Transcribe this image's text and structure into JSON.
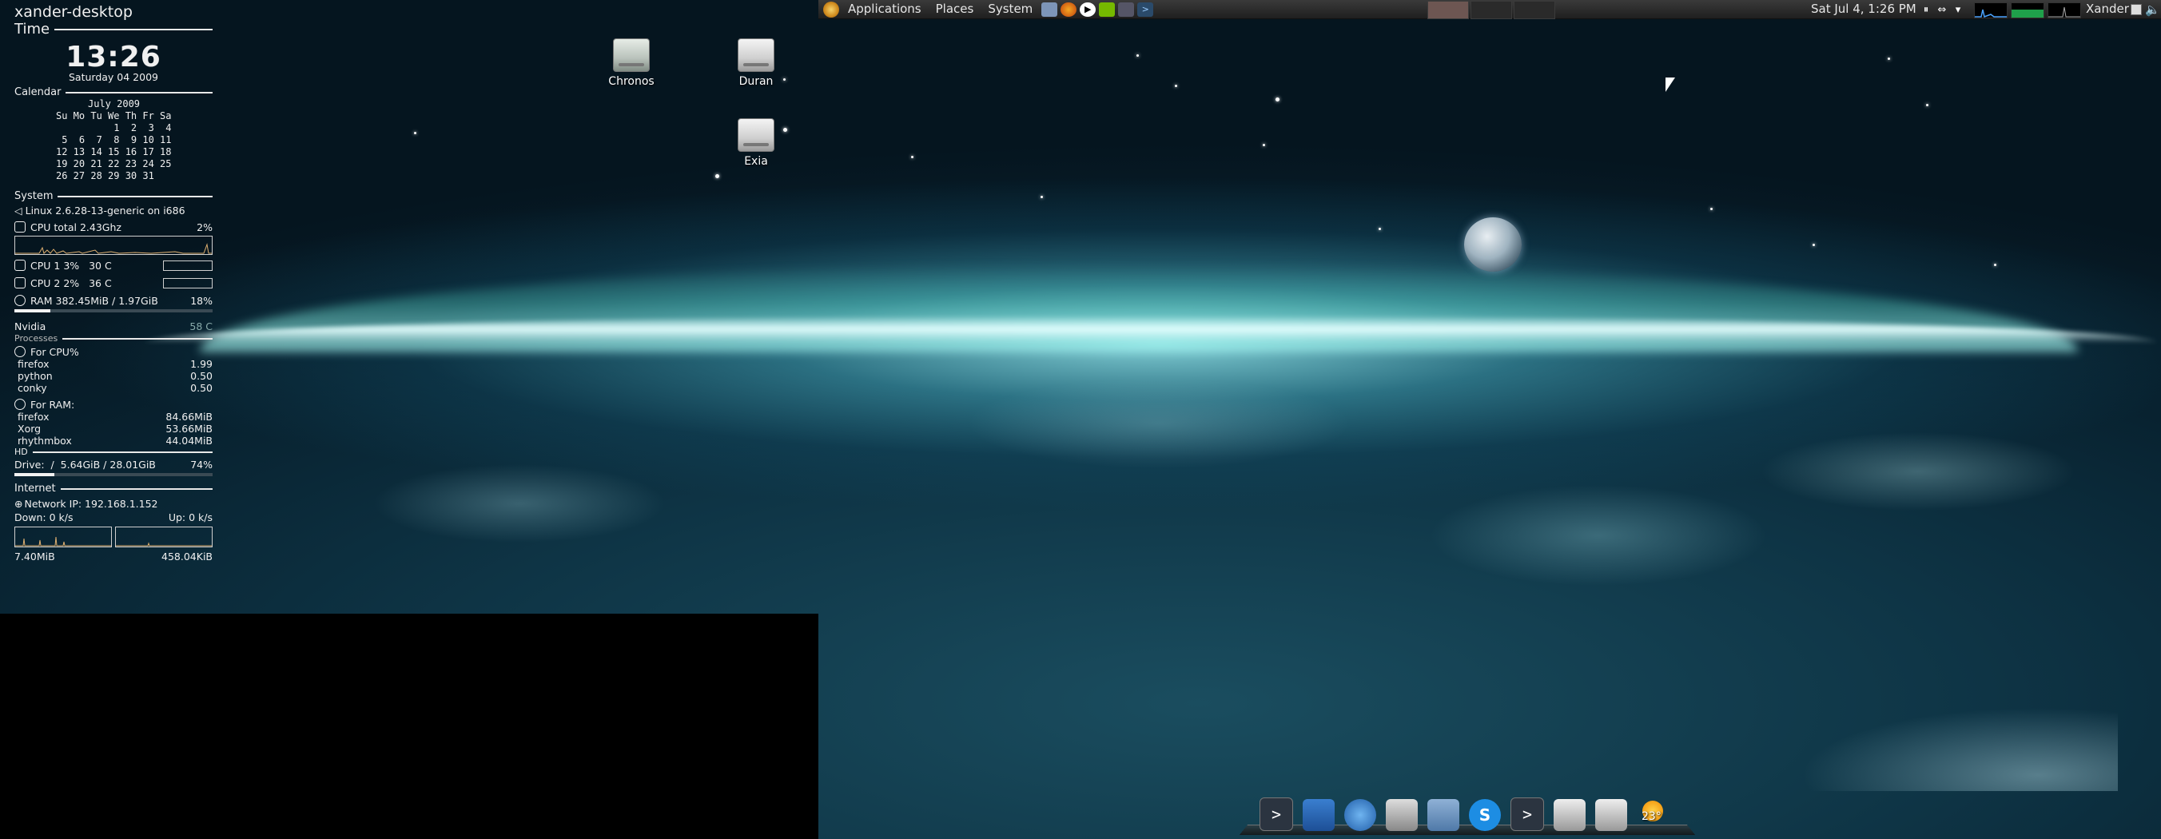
{
  "top_panel": {
    "menus": [
      "Applications",
      "Places",
      "System"
    ],
    "clock": "Sat Jul  4,  1:26 PM",
    "user": "Xander"
  },
  "desktop_icons": [
    {
      "label": "Chronos",
      "icon": "usb-drive-icon"
    },
    {
      "label": "Duran",
      "icon": "hard-drive-icon"
    },
    {
      "label": "Exia",
      "icon": "hard-drive-icon"
    }
  ],
  "conky": {
    "hostname": "xander-desktop",
    "time_section": "Time",
    "time": "13:26",
    "date": "Saturday 04 2009",
    "calendar_section": "Calendar",
    "calendar_month": "July 2009",
    "calendar_header": "Su Mo Tu We Th Fr Sa",
    "calendar_weeks": [
      "          1  2  3  4",
      " 5  6  7  8  9 10 11",
      "12 13 14 15 16 17 18",
      "19 20 21 22 23 24 25",
      "26 27 28 29 30 31"
    ],
    "system_section": "System",
    "kernel": "Linux 2.6.28-13-generic on i686",
    "cpu_total_label": "CPU total 2.43Ghz",
    "cpu_total_pct": "2%",
    "cpu1": "CPU 1 3%   30 C",
    "cpu2": "CPU 2 2%   36 C",
    "ram_label": "RAM  382.45MiB / 1.97GiB",
    "ram_pct": "18%",
    "ram_fraction": 0.18,
    "nvidia_label": "Nvidia",
    "nvidia_value": "58 C",
    "processes_section": "Processes",
    "cpu_procs_label": "For CPU%",
    "cpu_procs": [
      {
        "name": "firefox",
        "value": "1.99"
      },
      {
        "name": "python",
        "value": "0.50"
      },
      {
        "name": "conky",
        "value": "0.50"
      }
    ],
    "ram_procs_label": "For RAM:",
    "ram_procs": [
      {
        "name": "firefox",
        "value": "84.66MiB"
      },
      {
        "name": "Xorg",
        "value": "53.66MiB"
      },
      {
        "name": "rhythmbox",
        "value": "44.04MiB"
      }
    ],
    "hd_section": "HD",
    "drive_label": "Drive:  /  5.64GiB / 28.01GiB",
    "drive_pct": "74%",
    "drive_fraction": 0.2,
    "internet_section": "Internet",
    "network_ip": "Network IP: 192.168.1.152",
    "down": "Down: 0 k/s",
    "up": "Up: 0 k/s",
    "down_total": "7.40MiB",
    "up_total": "458.04KiB"
  },
  "dock": {
    "items": [
      "terminal-icon",
      "folder-icon",
      "web-browser-icon",
      "media-player-icon",
      "file-manager-icon",
      "skype-icon",
      "terminal-icon",
      "drive-icon",
      "drive-icon",
      "weather-icon"
    ],
    "weather_temp": "23°"
  }
}
